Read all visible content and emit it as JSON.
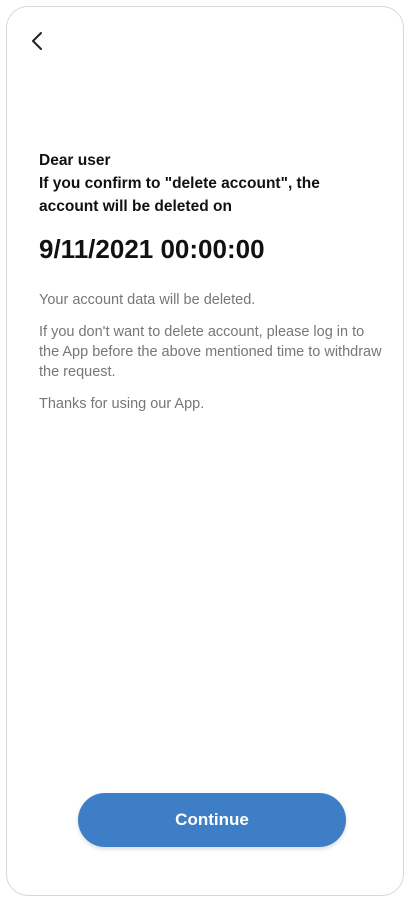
{
  "nav": {
    "back_icon": "chevron-left-icon"
  },
  "notice": {
    "greeting": "Dear user",
    "confirm_text": "If you confirm to \"delete account\", the account will be deleted on",
    "deletion_datetime": "9/11/2021 00:00:00",
    "data_deleted_text": "Your account data will be deleted.",
    "withdraw_text": "If you don't want to delete account, please log in to the App before the above mentioned time to withdraw the request.",
    "thanks_text": "Thanks for using our App."
  },
  "actions": {
    "continue_label": "Continue"
  },
  "colors": {
    "accent": "#3d7ec7",
    "text_primary": "#111111",
    "text_secondary": "#777777"
  }
}
